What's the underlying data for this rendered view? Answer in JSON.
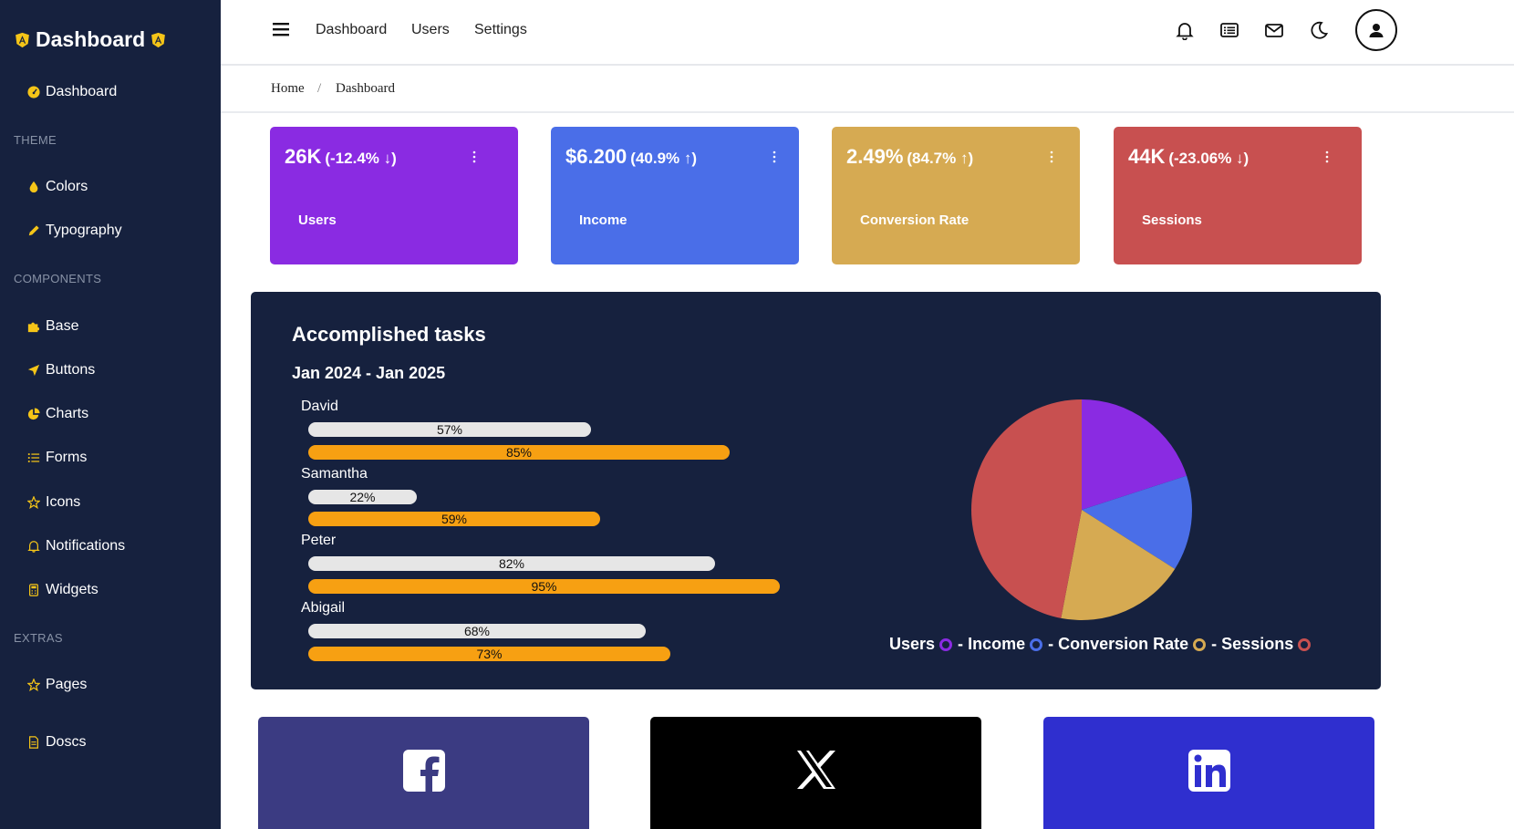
{
  "sidebar": {
    "brand": "Dashboard",
    "items": {
      "dashboard": "Dashboard",
      "colors": "Colors",
      "typography": "Typography",
      "base": "Base",
      "buttons": "Buttons",
      "charts": "Charts",
      "forms": "Forms",
      "icons": "Icons",
      "notifications": "Notifications",
      "widgets": "Widgets",
      "pages": "Pages",
      "docs": "Doscs"
    },
    "sections": {
      "theme": "THEME",
      "components": "COMPONENTS",
      "extras": "EXTRAS"
    }
  },
  "header": {
    "links": [
      "Dashboard",
      "Users",
      "Settings"
    ],
    "icons": [
      "bell-icon",
      "list-icon",
      "mail-icon",
      "moon-icon",
      "user-avatar-icon"
    ]
  },
  "breadcrumb": {
    "home": "Home",
    "separator": "/",
    "current": "Dashboard"
  },
  "stats": [
    {
      "value": "26K",
      "delta": "(-12.4% ↓)",
      "label": "Users",
      "color": "#8a2be2"
    },
    {
      "value": "$6.200",
      "delta": "(40.9% ↑)",
      "label": "Income",
      "color": "#4a6ee8"
    },
    {
      "value": "2.49%",
      "delta": "(84.7% ↑)",
      "label": "Conversion Rate",
      "color": "#d6aa52"
    },
    {
      "value": "44K",
      "delta": "(-23.06% ↓)",
      "label": "Sessions",
      "color": "#c85050"
    }
  ],
  "tasks": {
    "title": "Accomplished tasks",
    "period": "Jan 2024 - Jan 2025",
    "people": [
      {
        "name": "David",
        "first": "57%",
        "second": "85%"
      },
      {
        "name": "Samantha",
        "first": "22%",
        "second": "59%"
      },
      {
        "name": "Peter",
        "first": "82%",
        "second": "95%"
      },
      {
        "name": "Abigail",
        "first": "68%",
        "second": "73%"
      }
    ]
  },
  "chart_data": {
    "type": "pie",
    "slices": [
      {
        "label": "Users",
        "value": 20,
        "color": "#8a2be2"
      },
      {
        "label": "Income",
        "value": 14,
        "color": "#4a6ee8"
      },
      {
        "label": "Conversion Rate",
        "value": 19,
        "color": "#d6aa52"
      },
      {
        "label": "Sessions",
        "value": 47,
        "color": "#c85050"
      }
    ],
    "legend": "bottom"
  },
  "legend": {
    "items": [
      "Users",
      "Income",
      "Conversion Rate",
      "Sessions"
    ],
    "separator": "-"
  },
  "social": [
    {
      "name": "facebook-icon",
      "color": "#3b3b82"
    },
    {
      "name": "x-icon",
      "color": "#000000"
    },
    {
      "name": "linkedin-icon",
      "color": "#2f2fcf"
    }
  ]
}
